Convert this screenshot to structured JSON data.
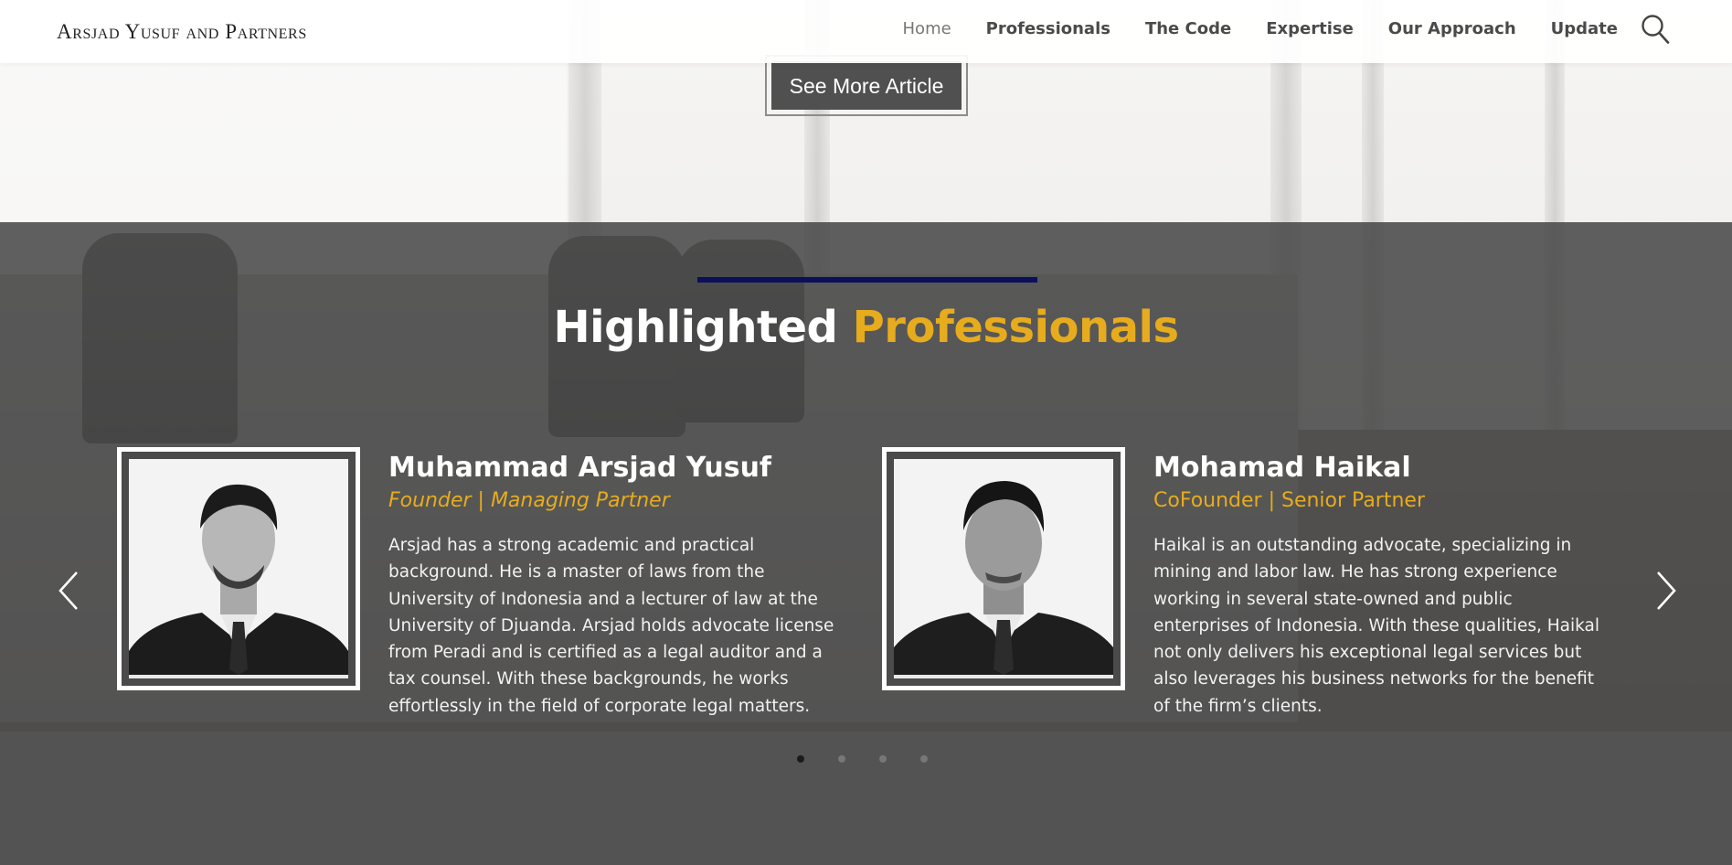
{
  "header": {
    "logo": "Arsjad Yusuf and Partners",
    "nav": [
      "Home",
      "Professionals",
      "The Code",
      "Expertise",
      "Our Approach",
      "Update"
    ],
    "active_nav": "Home"
  },
  "see_more_label": "See More Article",
  "section": {
    "title_white": "Highlighted",
    "title_yellow": "Professionals"
  },
  "professionals": [
    {
      "name": "Muhammad Arsjad Yusuf",
      "role": "Founder | Managing Partner",
      "bio": "Arsjad has a strong academic and practical background. He is a master of laws from the University of Indonesia and a lecturer of law at the University of Djuanda. Arsjad holds advocate license from Peradi and is certified as a legal auditor and a tax counsel. With these backgrounds, he works effortlessly in the field of corporate legal matters."
    },
    {
      "name": "Mohamad Haikal",
      "role": "CoFounder | Senior Partner",
      "bio": "Haikal is an outstanding advocate, specializing in mining and labor law. He has strong experience working in several state-owned and public enterprises of Indonesia. With these qualities, Haikal not only delivers his exceptional legal services but also leverages his business networks for the benefit of the firm’s clients."
    }
  ],
  "carousel": {
    "pages": 4,
    "active_page": 1
  },
  "colors": {
    "accent_yellow": "#e7ac1d",
    "accent_navy": "#0b0f5c",
    "button_bg": "#505050"
  },
  "icons": [
    "search-icon",
    "chevron-left-icon",
    "chevron-right-icon"
  ]
}
